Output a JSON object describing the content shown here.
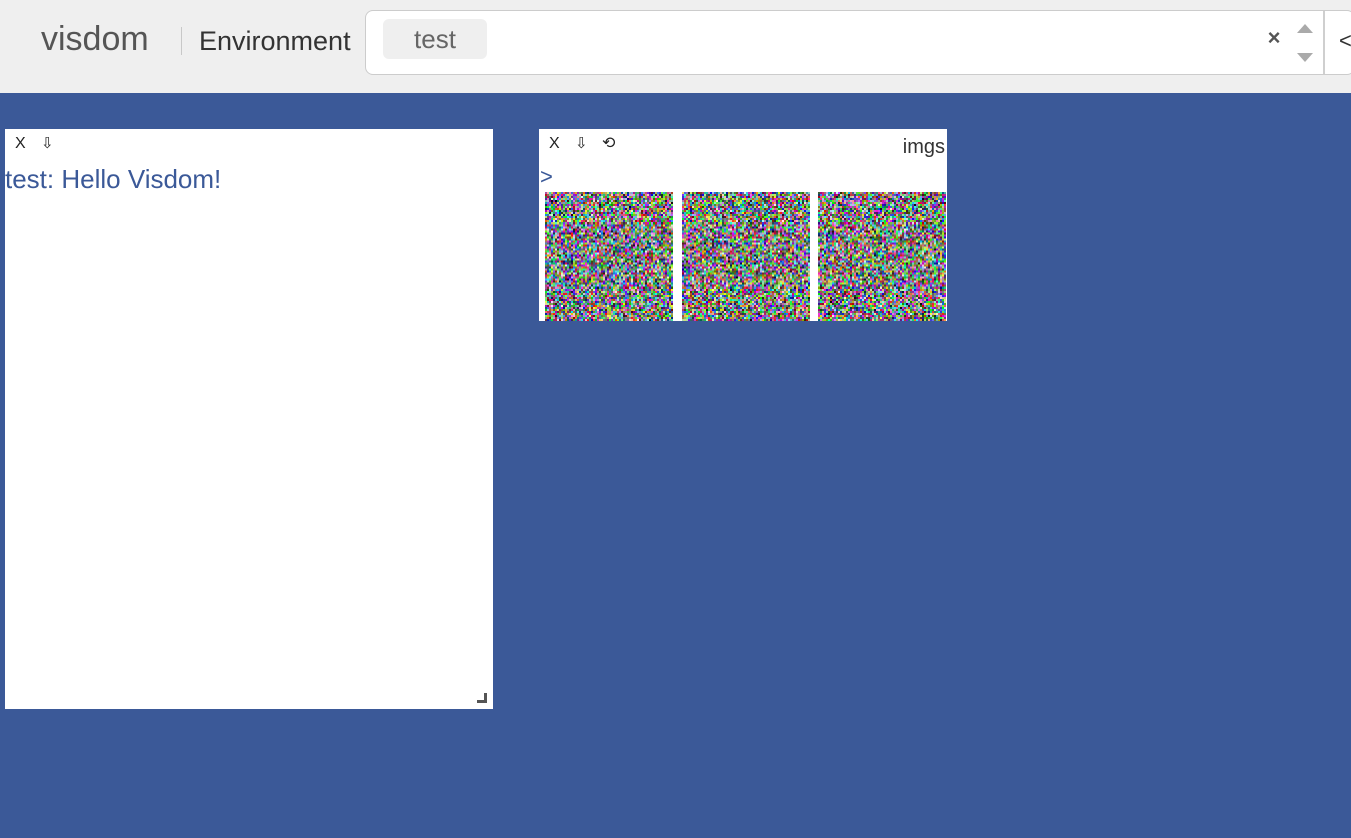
{
  "navbar": {
    "brand": "visdom",
    "env_label": "Environment",
    "env_selected": "test",
    "clear_glyph": "×",
    "cut_glyph": "<"
  },
  "panes": {
    "text_pane": {
      "close_label": "X",
      "download_label": "⇩",
      "content": "test: Hello Visdom!"
    },
    "images_pane": {
      "close_label": "X",
      "download_label": "⇩",
      "reset_label": "⟲",
      "title": "imgs",
      "expand_label": ">",
      "image_count": 3
    }
  },
  "colors": {
    "background": "#3b5998",
    "navbar": "#efefef",
    "accent_text": "#3b5998"
  },
  "icons": [
    "clear-icon",
    "caret-up-icon",
    "caret-down-icon",
    "close-icon",
    "download-icon",
    "reset-icon",
    "resize-handle-icon"
  ]
}
